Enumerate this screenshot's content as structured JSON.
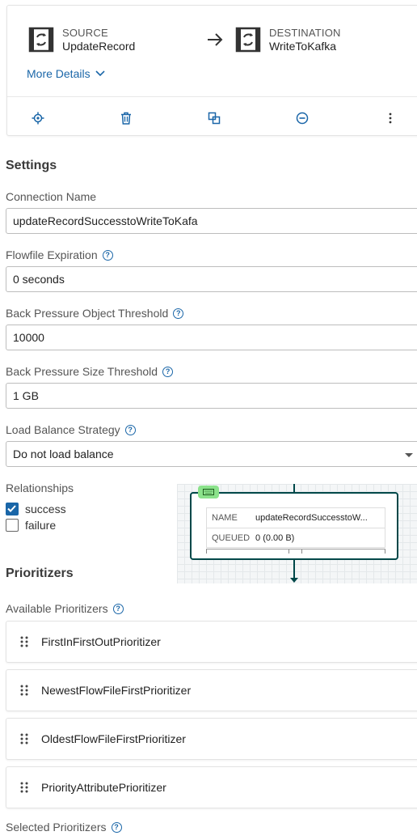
{
  "connection_card": {
    "source": {
      "kind": "SOURCE",
      "name": "UpdateRecord"
    },
    "destination": {
      "kind": "DESTINATION",
      "name": "WriteToKafka"
    },
    "more_details": "More Details",
    "actions": [
      "locate-icon",
      "delete-icon",
      "copy-icon",
      "remove-icon",
      "more-vert-icon"
    ]
  },
  "settings": {
    "heading": "Settings",
    "connection_name": {
      "label": "Connection Name",
      "value": "updateRecordSuccesstoWriteToKafa"
    },
    "flowfile_expiration": {
      "label": "Flowfile Expiration",
      "value": "0 seconds"
    },
    "bp_object_threshold": {
      "label": "Back Pressure Object Threshold",
      "value": "10000"
    },
    "bp_size_threshold": {
      "label": "Back Pressure Size Threshold",
      "value": "1 GB"
    },
    "load_balance": {
      "label": "Load Balance Strategy",
      "selected": "Do not load balance"
    }
  },
  "relationships": {
    "label": "Relationships",
    "items": [
      {
        "label": "success",
        "checked": true
      },
      {
        "label": "failure",
        "checked": false
      }
    ]
  },
  "preview": {
    "name_label": "NAME",
    "name_value": "updateRecordSuccesstoW...",
    "queued_label": "QUEUED",
    "queued_count": "0",
    "queued_size": "(0.00 B)"
  },
  "prioritizers": {
    "heading": "Prioritizers",
    "available_label": "Available Prioritizers",
    "available": [
      "FirstInFirstOutPrioritizer",
      "NewestFlowFileFirstPrioritizer",
      "OldestFlowFileFirstPrioritizer",
      "PriorityAttributePrioritizer"
    ],
    "selected_label": "Selected Prioritizers"
  },
  "colors": {
    "accent": "#1a66a8",
    "connection": "#004849",
    "badge": "#8be28b"
  }
}
